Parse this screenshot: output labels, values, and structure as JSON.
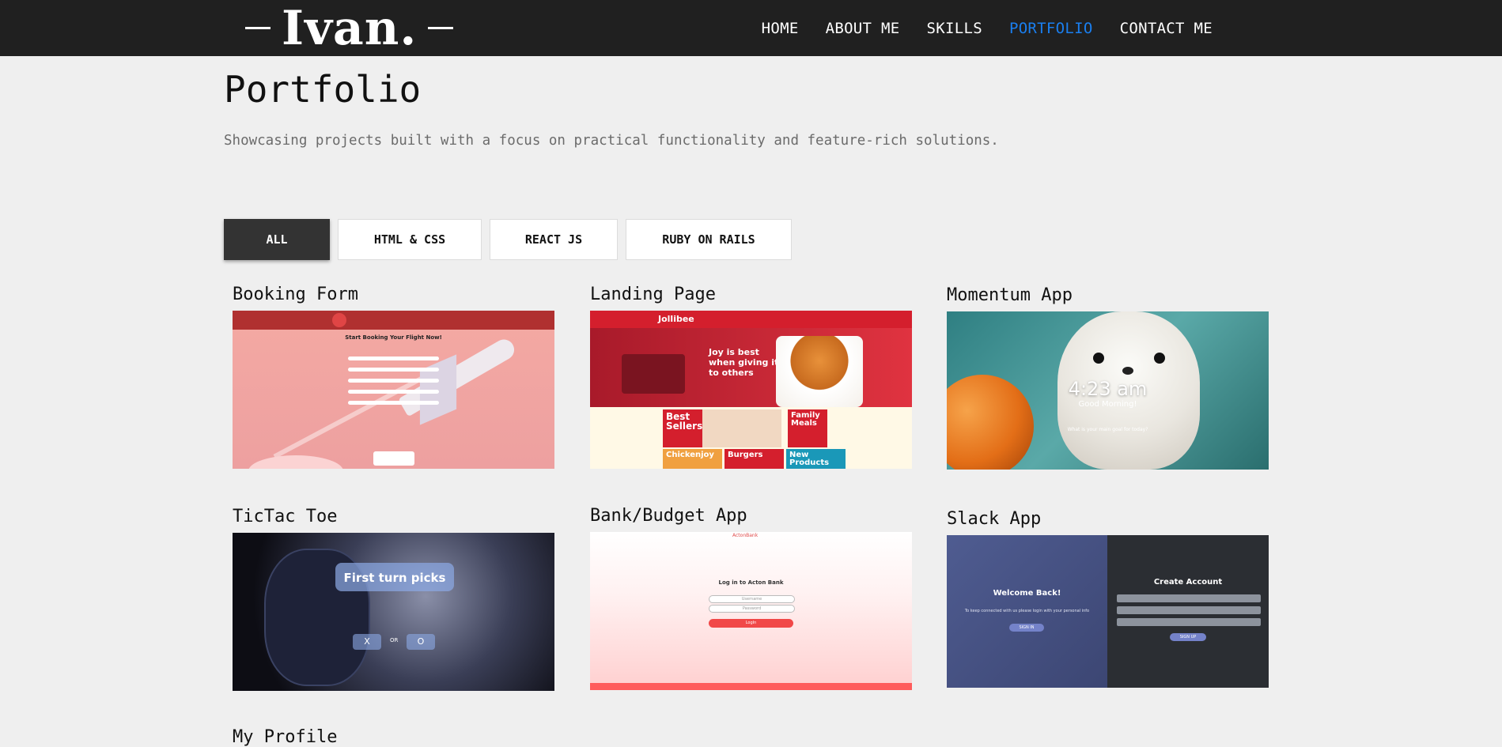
{
  "header": {
    "logo": "Ivan.",
    "nav": [
      "HOME",
      "ABOUT ME",
      "SKILLS",
      "PORTFOLIO",
      "CONTACT ME"
    ],
    "active_nav": "PORTFOLIO",
    "accent_color": "#1a7ff0"
  },
  "page": {
    "title": "Portfolio",
    "subtitle": "Showcasing projects built with a focus on practical functionality and feature-rich solutions."
  },
  "filters": {
    "items": [
      "ALL",
      "HTML & CSS",
      "REACT JS",
      "RUBY ON RAILS"
    ],
    "active": "ALL"
  },
  "projects": [
    {
      "title": "Booking Form",
      "thumb": {
        "heading": "Start Booking Your Flight Now!"
      }
    },
    {
      "title": "Landing Page",
      "thumb": {
        "brand": "Jollibee",
        "tagline": "Joy is best when giving it to others",
        "tiles": [
          "Best Sellers",
          "Family Meals",
          "Chickenjoy",
          "Burgers",
          "New Products"
        ]
      }
    },
    {
      "title": "Momentum App",
      "thumb": {
        "time": "4:23 am",
        "greeting": "Good Morning!",
        "question": "What is your main goal for today?"
      }
    },
    {
      "title": "TicTac Toe",
      "thumb": {
        "banner": "First turn picks",
        "x": "X",
        "or": "OR",
        "o": "O"
      }
    },
    {
      "title": "Bank/Budget App",
      "thumb": {
        "brand": "ActonBank",
        "heading": "Log in to Acton Bank",
        "username": "Username",
        "password": "Password",
        "button": "LogIn"
      }
    },
    {
      "title": "Slack App",
      "thumb": {
        "left_title": "Welcome Back!",
        "left_sub": "To keep connected with us please login with your personal info",
        "left_btn": "SIGN IN",
        "right_title": "Create Account",
        "right_btn": "SIGN UP"
      }
    },
    {
      "title": "My Profile"
    }
  ]
}
